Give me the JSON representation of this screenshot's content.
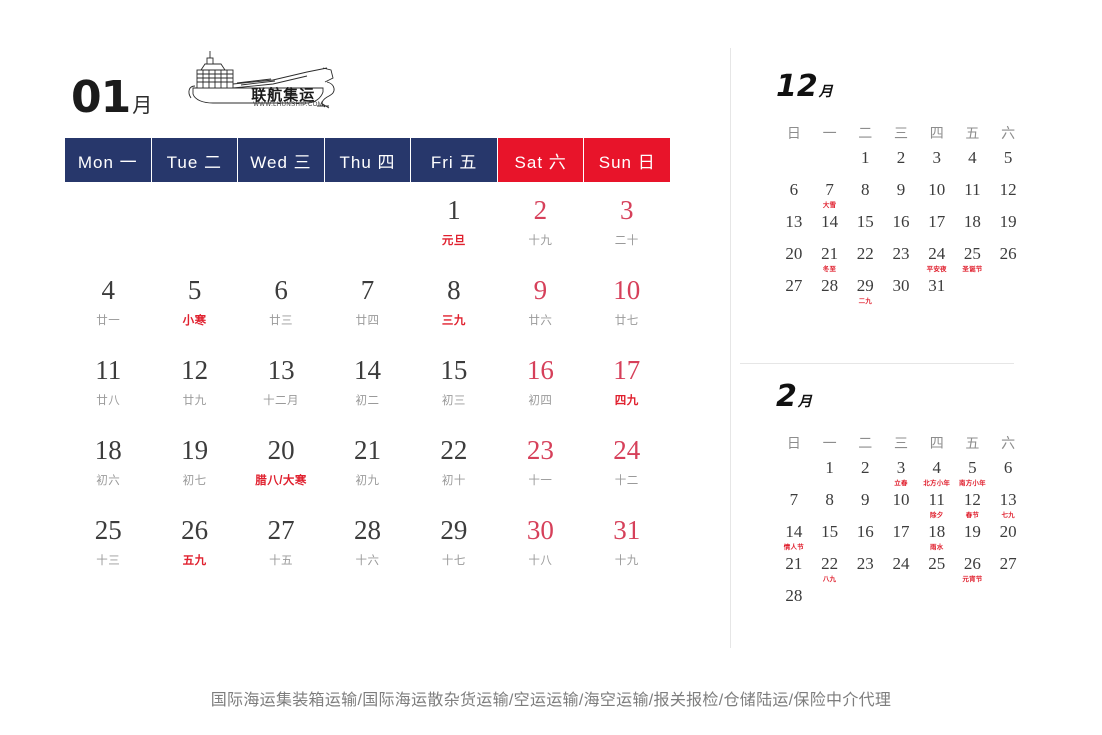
{
  "colors": {
    "header_navy": "#27376b",
    "header_red": "#e8142a",
    "weekend_number": "#d6405a",
    "festival_red": "#e0202e",
    "lunar_gray": "#9a9a9a"
  },
  "main": {
    "month_number": "01",
    "month_suffix": "月",
    "logo": {
      "company_cn": "联航集运",
      "url": "WWW.LHUNSHIP.COM",
      "icon": "cargo-ship-icon"
    },
    "weekdays": [
      {
        "label": "Mon 一",
        "weekend": false
      },
      {
        "label": "Tue 二",
        "weekend": false
      },
      {
        "label": "Wed 三",
        "weekend": false
      },
      {
        "label": "Thu 四",
        "weekend": false
      },
      {
        "label": "Fri 五",
        "weekend": false
      },
      {
        "label": "Sat 六",
        "weekend": true
      },
      {
        "label": "Sun 日",
        "weekend": true
      }
    ],
    "weeks": [
      [
        {
          "num": "",
          "lunar": "",
          "empty": true
        },
        {
          "num": "",
          "lunar": "",
          "empty": true
        },
        {
          "num": "",
          "lunar": "",
          "empty": true
        },
        {
          "num": "",
          "lunar": "",
          "empty": true
        },
        {
          "num": "1",
          "lunar": "元旦",
          "festival": true,
          "weekend": false
        },
        {
          "num": "2",
          "lunar": "十九",
          "festival": false,
          "weekend": true
        },
        {
          "num": "3",
          "lunar": "二十",
          "festival": false,
          "weekend": true
        }
      ],
      [
        {
          "num": "4",
          "lunar": "廿一",
          "festival": false,
          "weekend": false
        },
        {
          "num": "5",
          "lunar": "小寒",
          "festival": true,
          "weekend": false
        },
        {
          "num": "6",
          "lunar": "廿三",
          "festival": false,
          "weekend": false
        },
        {
          "num": "7",
          "lunar": "廿四",
          "festival": false,
          "weekend": false
        },
        {
          "num": "8",
          "lunar": "三九",
          "festival": true,
          "weekend": false
        },
        {
          "num": "9",
          "lunar": "廿六",
          "festival": false,
          "weekend": true
        },
        {
          "num": "10",
          "lunar": "廿七",
          "festival": false,
          "weekend": true
        }
      ],
      [
        {
          "num": "11",
          "lunar": "廿八",
          "festival": false,
          "weekend": false
        },
        {
          "num": "12",
          "lunar": "廿九",
          "festival": false,
          "weekend": false
        },
        {
          "num": "13",
          "lunar": "十二月",
          "festival": false,
          "weekend": false
        },
        {
          "num": "14",
          "lunar": "初二",
          "festival": false,
          "weekend": false
        },
        {
          "num": "15",
          "lunar": "初三",
          "festival": false,
          "weekend": false
        },
        {
          "num": "16",
          "lunar": "初四",
          "festival": false,
          "weekend": true
        },
        {
          "num": "17",
          "lunar": "四九",
          "festival": true,
          "weekend": true
        }
      ],
      [
        {
          "num": "18",
          "lunar": "初六",
          "festival": false,
          "weekend": false
        },
        {
          "num": "19",
          "lunar": "初七",
          "festival": false,
          "weekend": false
        },
        {
          "num": "20",
          "lunar": "腊八/大寒",
          "festival": true,
          "weekend": false
        },
        {
          "num": "21",
          "lunar": "初九",
          "festival": false,
          "weekend": false
        },
        {
          "num": "22",
          "lunar": "初十",
          "festival": false,
          "weekend": false
        },
        {
          "num": "23",
          "lunar": "十一",
          "festival": false,
          "weekend": true
        },
        {
          "num": "24",
          "lunar": "十二",
          "festival": false,
          "weekend": true
        }
      ],
      [
        {
          "num": "25",
          "lunar": "十三",
          "festival": false,
          "weekend": false
        },
        {
          "num": "26",
          "lunar": "五九",
          "festival": true,
          "weekend": false
        },
        {
          "num": "27",
          "lunar": "十五",
          "festival": false,
          "weekend": false
        },
        {
          "num": "28",
          "lunar": "十六",
          "festival": false,
          "weekend": false
        },
        {
          "num": "29",
          "lunar": "十七",
          "festival": false,
          "weekend": false
        },
        {
          "num": "30",
          "lunar": "十八",
          "festival": false,
          "weekend": true
        },
        {
          "num": "31",
          "lunar": "十九",
          "festival": false,
          "weekend": true
        }
      ]
    ]
  },
  "mini_calendars": [
    {
      "month_number": "12",
      "month_suffix": "月",
      "weekdays": [
        "日",
        "一",
        "二",
        "三",
        "四",
        "五",
        "六"
      ],
      "days": [
        {
          "num": "",
          "empty": true
        },
        {
          "num": "",
          "empty": true
        },
        {
          "num": "1"
        },
        {
          "num": "2"
        },
        {
          "num": "3"
        },
        {
          "num": "4"
        },
        {
          "num": "5"
        },
        {
          "num": "6"
        },
        {
          "num": "7",
          "festival": "大雪"
        },
        {
          "num": "8"
        },
        {
          "num": "9"
        },
        {
          "num": "10"
        },
        {
          "num": "11"
        },
        {
          "num": "12"
        },
        {
          "num": "13"
        },
        {
          "num": "14"
        },
        {
          "num": "15"
        },
        {
          "num": "16"
        },
        {
          "num": "17"
        },
        {
          "num": "18"
        },
        {
          "num": "19"
        },
        {
          "num": "20"
        },
        {
          "num": "21",
          "festival": "冬至"
        },
        {
          "num": "22"
        },
        {
          "num": "23"
        },
        {
          "num": "24",
          "festival": "平安夜"
        },
        {
          "num": "25",
          "festival": "圣诞节"
        },
        {
          "num": "26"
        },
        {
          "num": "27"
        },
        {
          "num": "28"
        },
        {
          "num": "29",
          "festival": "二九"
        },
        {
          "num": "30"
        },
        {
          "num": "31"
        }
      ]
    },
    {
      "month_number": "2",
      "month_suffix": "月",
      "weekdays": [
        "日",
        "一",
        "二",
        "三",
        "四",
        "五",
        "六"
      ],
      "days": [
        {
          "num": "",
          "empty": true
        },
        {
          "num": "1"
        },
        {
          "num": "2"
        },
        {
          "num": "3",
          "festival": "立春"
        },
        {
          "num": "4",
          "festival": "北方小年"
        },
        {
          "num": "5",
          "festival": "南方小年"
        },
        {
          "num": "6"
        },
        {
          "num": "7"
        },
        {
          "num": "8"
        },
        {
          "num": "9"
        },
        {
          "num": "10"
        },
        {
          "num": "11",
          "festival": "除夕"
        },
        {
          "num": "12",
          "festival": "春节"
        },
        {
          "num": "13",
          "festival": "七九"
        },
        {
          "num": "14",
          "festival": "情人节"
        },
        {
          "num": "15"
        },
        {
          "num": "16"
        },
        {
          "num": "17"
        },
        {
          "num": "18",
          "festival": "雨水"
        },
        {
          "num": "19"
        },
        {
          "num": "20"
        },
        {
          "num": "21"
        },
        {
          "num": "22",
          "festival": "八九"
        },
        {
          "num": "23"
        },
        {
          "num": "24"
        },
        {
          "num": "25"
        },
        {
          "num": "26",
          "festival": "元宵节"
        },
        {
          "num": "27"
        },
        {
          "num": "28"
        }
      ]
    }
  ],
  "footer": {
    "services": "国际海运集装箱运输/国际海运散杂货运输/空运运输/海空运输/报关报检/仓储陆运/保险中介代理"
  }
}
